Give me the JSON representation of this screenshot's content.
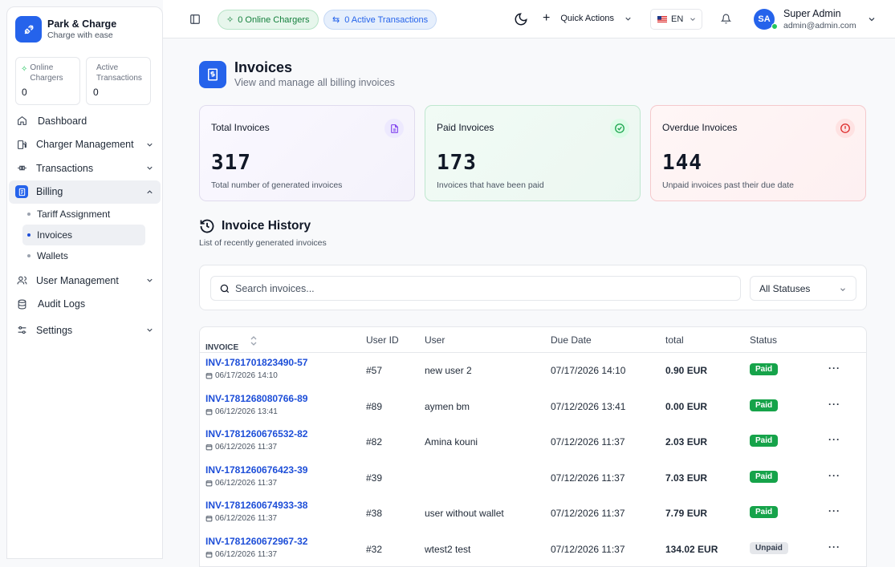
{
  "brand": {
    "title": "Park & Charge",
    "subtitle": "Charge with ease"
  },
  "sidebar_stats": [
    {
      "label_line1": "Online",
      "label_line2": "Chargers",
      "value": "0"
    },
    {
      "label_line1": "Active",
      "label_line2": "Transactions",
      "value": "0"
    }
  ],
  "nav": {
    "dashboard": "Dashboard",
    "charger_management": "Charger Management",
    "transactions": "Transactions",
    "billing": "Billing",
    "billing_sub": [
      "Tariff Assignment",
      "Invoices",
      "Wallets"
    ],
    "user_management": "User Management",
    "audit_logs": "Audit Logs",
    "settings": "Settings"
  },
  "topbar": {
    "online_chargers": "0 Online Chargers",
    "active_transactions": "0 Active Transactions",
    "quick_actions": "Quick Actions",
    "language": "EN",
    "user_initials": "SA",
    "user_name": "Super Admin",
    "user_email": "admin@admin.com"
  },
  "page": {
    "title": "Invoices",
    "subtitle": "View and manage all billing invoices"
  },
  "stats": [
    {
      "title": "Total Invoices",
      "value": "317",
      "desc": "Total number of generated invoices"
    },
    {
      "title": "Paid Invoices",
      "value": "173",
      "desc": "Invoices that have been paid"
    },
    {
      "title": "Overdue Invoices",
      "value": "144",
      "desc": "Unpaid invoices past their due date"
    }
  ],
  "history": {
    "title": "Invoice History",
    "subtitle": "List of recently generated invoices"
  },
  "filters": {
    "search_placeholder": "Search invoices...",
    "status_selected": "All Statuses"
  },
  "table": {
    "headers": {
      "invoice": "INVOICE",
      "user_id": "User ID",
      "user": "User",
      "due_date": "Due Date",
      "total": "total",
      "status": "Status"
    },
    "rows": [
      {
        "invoice": "INV-1781701823490-57",
        "date": "06/17/2026 14:10",
        "user_id": "#57",
        "user": "new user 2",
        "due": "07/17/2026 14:10",
        "total": "0.90 EUR",
        "status": "Paid"
      },
      {
        "invoice": "INV-1781268080766-89",
        "date": "06/12/2026 13:41",
        "user_id": "#89",
        "user": "aymen bm",
        "due": "07/12/2026 13:41",
        "total": "0.00 EUR",
        "status": "Paid"
      },
      {
        "invoice": "INV-1781260676532-82",
        "date": "06/12/2026 11:37",
        "user_id": "#82",
        "user": "Amina kouni",
        "due": "07/12/2026 11:37",
        "total": "2.03 EUR",
        "status": "Paid"
      },
      {
        "invoice": "INV-1781260676423-39",
        "date": "06/12/2026 11:37",
        "user_id": "#39",
        "user": "",
        "due": "07/12/2026 11:37",
        "total": "7.03 EUR",
        "status": "Paid"
      },
      {
        "invoice": "INV-1781260674933-38",
        "date": "06/12/2026 11:37",
        "user_id": "#38",
        "user": "user without wallet",
        "due": "07/12/2026 11:37",
        "total": "7.79 EUR",
        "status": "Paid"
      },
      {
        "invoice": "INV-1781260672967-32",
        "date": "06/12/2026 11:37",
        "user_id": "#32",
        "user": "wtest2 test",
        "due": "07/12/2026 11:37",
        "total": "134.02 EUR",
        "status": "Unpaid"
      }
    ]
  },
  "colors": {
    "primary": "#2563eb",
    "paid": "#16a34a",
    "overdue": "#dc2626",
    "purple": "#7c3aed"
  }
}
